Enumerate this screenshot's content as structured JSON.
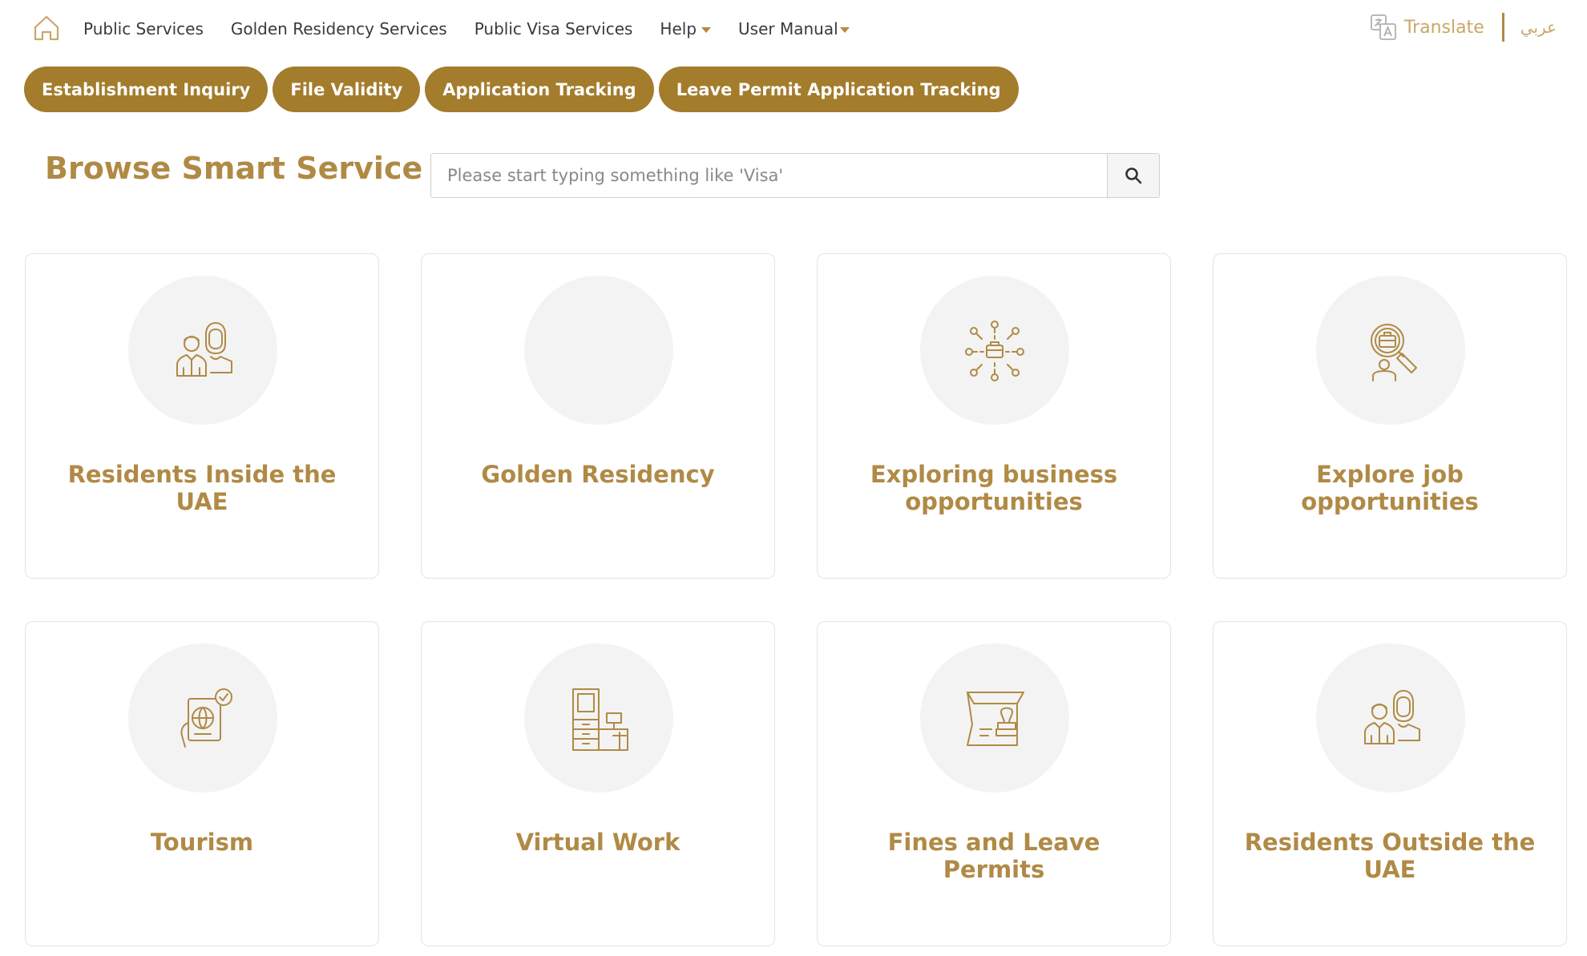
{
  "nav": {
    "links": [
      {
        "label": "Public Services",
        "dropdown": false
      },
      {
        "label": "Golden Residency Services",
        "dropdown": false
      },
      {
        "label": "Public Visa Services",
        "dropdown": false
      },
      {
        "label": "Help",
        "dropdown": true
      },
      {
        "label": "User Manual",
        "dropdown": true
      }
    ],
    "translate_label": "Translate",
    "language_label": "عربي"
  },
  "quick_links": [
    "Establishment Inquiry",
    "File Validity",
    "Application Tracking",
    "Leave Permit Application Tracking"
  ],
  "browse": {
    "title": "Browse Smart Service",
    "search_placeholder": "Please start typing something like 'Visa'"
  },
  "cards": [
    {
      "label": "Residents Inside the UAE",
      "icon": "residents-icon"
    },
    {
      "label": "Golden Residency",
      "icon": "none"
    },
    {
      "label": "Exploring business opportunities",
      "icon": "business-network-icon"
    },
    {
      "label": "Explore job opportunities",
      "icon": "job-search-icon"
    },
    {
      "label": "Tourism",
      "icon": "passport-globe-icon"
    },
    {
      "label": "Virtual Work",
      "icon": "workstation-icon"
    },
    {
      "label": "Fines and Leave Permits",
      "icon": "stamp-icon"
    },
    {
      "label": "Residents Outside the UAE",
      "icon": "residents-icon"
    }
  ],
  "colors": {
    "accent": "#a37c2c",
    "title": "#b08a45",
    "icon": "#b08a45",
    "card_border": "#e4e4e4",
    "circle_bg": "#f3f3f3"
  }
}
